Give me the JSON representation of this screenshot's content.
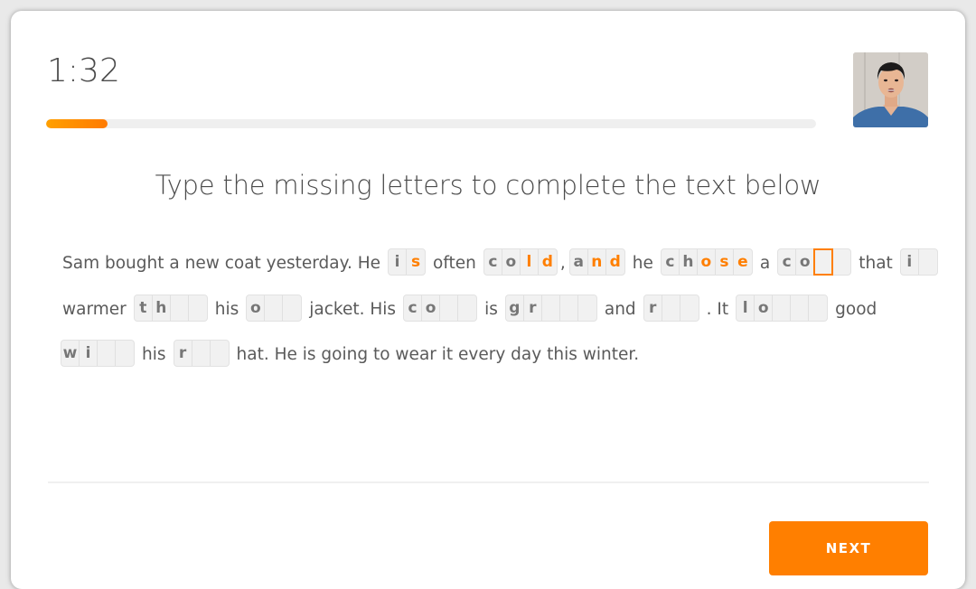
{
  "header": {
    "timer": "1:32",
    "progress_fraction": 0.08,
    "avatar_icon": "user-video-avatar"
  },
  "instruction": "Type the missing letters to complete the text below",
  "passage": [
    {
      "type": "text",
      "value": "Sam bought a new coat yesterday. He"
    },
    {
      "type": "blank",
      "cells": [
        {
          "ch": "i",
          "state": "given"
        },
        {
          "ch": "s",
          "state": "typed"
        }
      ]
    },
    {
      "type": "text",
      "value": "often"
    },
    {
      "type": "blank",
      "cells": [
        {
          "ch": "c",
          "state": "given"
        },
        {
          "ch": "o",
          "state": "given"
        },
        {
          "ch": "l",
          "state": "typed"
        },
        {
          "ch": "d",
          "state": "typed"
        }
      ]
    },
    {
      "type": "text",
      "value": ",",
      "tight": true
    },
    {
      "type": "blank",
      "cells": [
        {
          "ch": "a",
          "state": "given"
        },
        {
          "ch": "n",
          "state": "typed"
        },
        {
          "ch": "d",
          "state": "typed"
        }
      ]
    },
    {
      "type": "text",
      "value": "he"
    },
    {
      "type": "blank",
      "cells": [
        {
          "ch": "c",
          "state": "given"
        },
        {
          "ch": "h",
          "state": "given"
        },
        {
          "ch": "o",
          "state": "typed"
        },
        {
          "ch": "s",
          "state": "typed"
        },
        {
          "ch": "e",
          "state": "typed"
        }
      ]
    },
    {
      "type": "text",
      "value": "a"
    },
    {
      "type": "blank",
      "cells": [
        {
          "ch": "c",
          "state": "given"
        },
        {
          "ch": "o",
          "state": "given"
        },
        {
          "ch": "",
          "state": "active"
        },
        {
          "ch": "",
          "state": "empty"
        }
      ]
    },
    {
      "type": "text",
      "value": "that"
    },
    {
      "type": "blank",
      "cells": [
        {
          "ch": "i",
          "state": "given"
        },
        {
          "ch": "",
          "state": "empty"
        }
      ]
    },
    {
      "type": "text",
      "value": "warmer"
    },
    {
      "type": "blank",
      "cells": [
        {
          "ch": "t",
          "state": "given"
        },
        {
          "ch": "h",
          "state": "given"
        },
        {
          "ch": "",
          "state": "empty"
        },
        {
          "ch": "",
          "state": "empty"
        }
      ]
    },
    {
      "type": "text",
      "value": "his"
    },
    {
      "type": "blank",
      "cells": [
        {
          "ch": "o",
          "state": "given"
        },
        {
          "ch": "",
          "state": "empty"
        },
        {
          "ch": "",
          "state": "empty"
        }
      ]
    },
    {
      "type": "text",
      "value": "jacket.  His"
    },
    {
      "type": "blank",
      "cells": [
        {
          "ch": "c",
          "state": "given"
        },
        {
          "ch": "o",
          "state": "given"
        },
        {
          "ch": "",
          "state": "empty"
        },
        {
          "ch": "",
          "state": "empty"
        }
      ]
    },
    {
      "type": "text",
      "value": "is"
    },
    {
      "type": "blank",
      "cells": [
        {
          "ch": "g",
          "state": "given"
        },
        {
          "ch": "r",
          "state": "given"
        },
        {
          "ch": "",
          "state": "empty"
        },
        {
          "ch": "",
          "state": "empty"
        },
        {
          "ch": "",
          "state": "empty"
        }
      ]
    },
    {
      "type": "text",
      "value": "and"
    },
    {
      "type": "blank",
      "cells": [
        {
          "ch": "r",
          "state": "given"
        },
        {
          "ch": "",
          "state": "empty"
        },
        {
          "ch": "",
          "state": "empty"
        }
      ]
    },
    {
      "type": "text",
      "value": ". It"
    },
    {
      "type": "blank",
      "cells": [
        {
          "ch": "l",
          "state": "given"
        },
        {
          "ch": "o",
          "state": "given"
        },
        {
          "ch": "",
          "state": "empty"
        },
        {
          "ch": "",
          "state": "empty"
        },
        {
          "ch": "",
          "state": "empty"
        }
      ]
    },
    {
      "type": "text",
      "value": "good"
    },
    {
      "type": "blank",
      "cells": [
        {
          "ch": "w",
          "state": "given"
        },
        {
          "ch": "i",
          "state": "given"
        },
        {
          "ch": "",
          "state": "empty"
        },
        {
          "ch": "",
          "state": "empty"
        }
      ]
    },
    {
      "type": "text",
      "value": "his"
    },
    {
      "type": "blank",
      "cells": [
        {
          "ch": "r",
          "state": "given"
        },
        {
          "ch": "",
          "state": "empty"
        },
        {
          "ch": "",
          "state": "empty"
        }
      ]
    },
    {
      "type": "text",
      "value": "hat. He is going to wear it every day this winter."
    }
  ],
  "footer": {
    "next_label": "NEXT"
  },
  "colors": {
    "accent": "#ff7f00",
    "progress_start": "#ffa000",
    "text": "#4b4b4b",
    "given_letter": "#777777",
    "blank_bg": "#f1f1f1"
  }
}
